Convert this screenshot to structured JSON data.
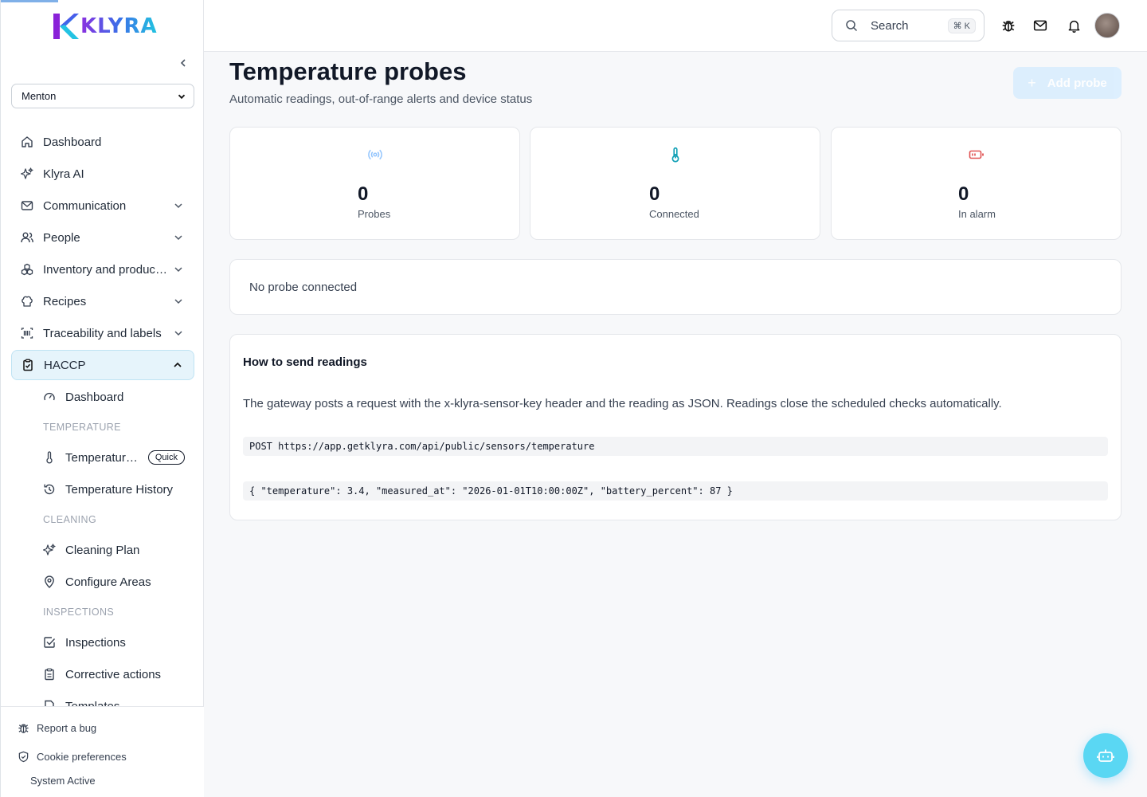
{
  "brand": {
    "name": "KLYRA"
  },
  "sidebar": {
    "site_selected": "Menton",
    "items": [
      {
        "label": "Dashboard",
        "icon": "home-icon"
      },
      {
        "label": "Klyra AI",
        "icon": "sparkles-icon"
      },
      {
        "label": "Communication",
        "icon": "mail-icon"
      },
      {
        "label": "People",
        "icon": "users-icon"
      },
      {
        "label": "Inventory and production",
        "icon": "boxes-icon"
      },
      {
        "label": "Recipes",
        "icon": "chef-hat-icon"
      },
      {
        "label": "Traceability and labels",
        "icon": "barcode-icon"
      },
      {
        "label": "HACCP",
        "icon": "clipboard-check-icon"
      }
    ],
    "haccp": {
      "dashboard": "Dashboard",
      "section_temperature": "TEMPERATURE",
      "temperature": "Temperature probes",
      "quick_badge": "Quick",
      "temperature_history": "Temperature History",
      "section_cleaning": "CLEANING",
      "cleaning_plan": "Cleaning Plan",
      "configure_areas": "Configure Areas",
      "section_inspections": "INSPECTIONS",
      "inspections": "Inspections",
      "corrective_actions": "Corrective actions",
      "templates": "Templates"
    },
    "bottom": {
      "report_bug": "Report a bug",
      "cookie_prefs": "Cookie preferences",
      "status": "System Active"
    }
  },
  "header": {
    "search_placeholder": "Search",
    "search_shortcut": "⌘ K"
  },
  "page": {
    "title": "Temperature probes",
    "subtitle": "Automatic readings, out-of-range alerts and device status",
    "add_button": "Add probe"
  },
  "stats": [
    {
      "value": "0",
      "label": "Probes",
      "icon": "radio-signal-icon",
      "color": "#93c5fd"
    },
    {
      "value": "0",
      "label": "Connected",
      "icon": "thermometer-icon",
      "color": "#0e9fb5"
    },
    {
      "value": "0",
      "label": "In alarm",
      "icon": "battery-low-icon",
      "color": "#e05252"
    }
  ],
  "empty_state": "No probe connected",
  "howto": {
    "title": "How to send readings",
    "description": "The gateway posts a request with the x-klyra-sensor-key header and the reading as JSON. Readings close the scheduled checks automatically.",
    "endpoint": "POST https://app.getklyra.com/api/public/sensors/temperature",
    "payload": "{ \"temperature\": 3.4, \"measured_at\": \"2026-01-01T10:00:00Z\", \"battery_percent\": 87 }"
  },
  "colors": {
    "accent": "#5ad7f3",
    "active_bg": "#e6f4fb",
    "brand_start": "#8b2fe0",
    "brand_end": "#22c5e0"
  }
}
